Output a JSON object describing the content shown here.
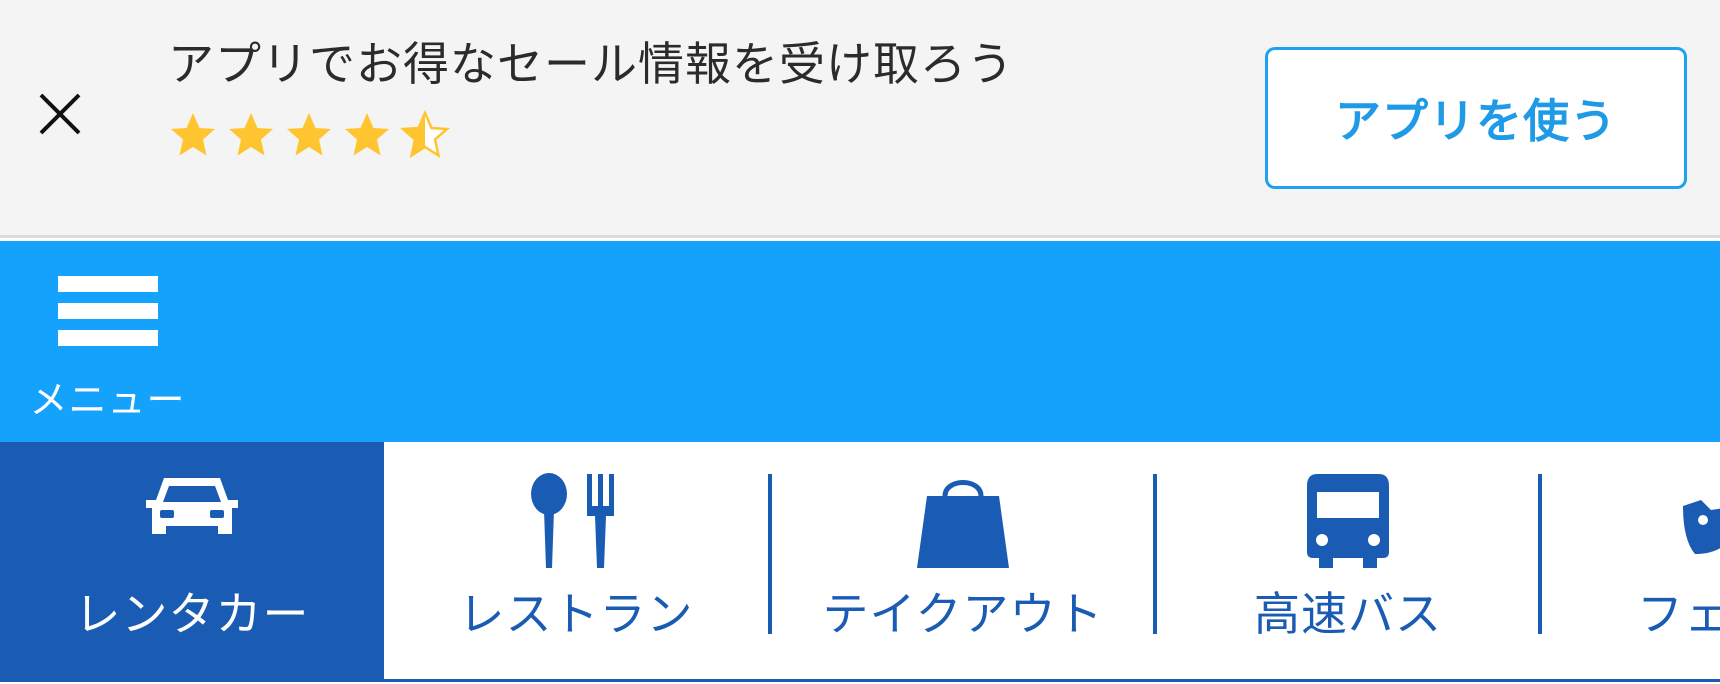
{
  "banner": {
    "title": "アプリでお得なセール情報を受け取ろう",
    "rating": 4.5,
    "star_icon": "star-icon",
    "star_color": "#ffc531",
    "cta_label": "アプリを使う",
    "close_icon": "close-icon"
  },
  "header": {
    "menu_label": "メニュー",
    "menu_icon": "hamburger-icon",
    "background": "#14a2fd"
  },
  "tabs": [
    {
      "label": "レンタカー",
      "icon": "car-icon",
      "active": true
    },
    {
      "label": "レストラン",
      "icon": "spoon-fork-icon",
      "active": false
    },
    {
      "label": "テイクアウト",
      "icon": "shopping-bag-icon",
      "active": false
    },
    {
      "label": "高速バス",
      "icon": "bus-icon",
      "active": false
    },
    {
      "label": "フェ",
      "icon": "ferry-icon",
      "active": false
    }
  ],
  "colors": {
    "accent_dark": "#1a5cb3",
    "accent_light": "#1e9ae6"
  }
}
